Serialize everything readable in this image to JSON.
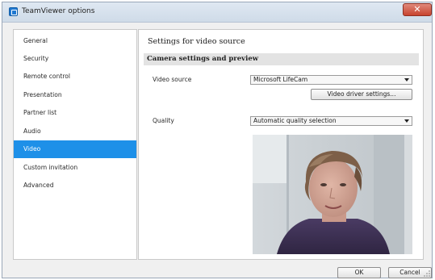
{
  "window": {
    "title": "TeamViewer options",
    "close_symbol": "✕"
  },
  "sidebar": {
    "items": [
      {
        "label": "General"
      },
      {
        "label": "Security"
      },
      {
        "label": "Remote control"
      },
      {
        "label": "Presentation"
      },
      {
        "label": "Partner list"
      },
      {
        "label": "Audio"
      },
      {
        "label": "Video",
        "selected": true
      },
      {
        "label": "Custom invitation"
      },
      {
        "label": "Advanced"
      }
    ]
  },
  "main": {
    "title": "Settings for video source",
    "section_title": "Camera settings and preview",
    "video_source": {
      "label": "Video source",
      "value": "Microsoft LifeCam"
    },
    "driver_button": "Video driver settings...",
    "quality": {
      "label": "Quality",
      "value": "Automatic quality selection"
    },
    "preview": {
      "icon": "camera-preview-image"
    }
  },
  "footer": {
    "ok_label": "OK",
    "cancel_label": "Cancel"
  },
  "colors": {
    "selection": "#1e90e8",
    "close_button": "#c8442f",
    "section_bar": "#e3e3e3"
  }
}
